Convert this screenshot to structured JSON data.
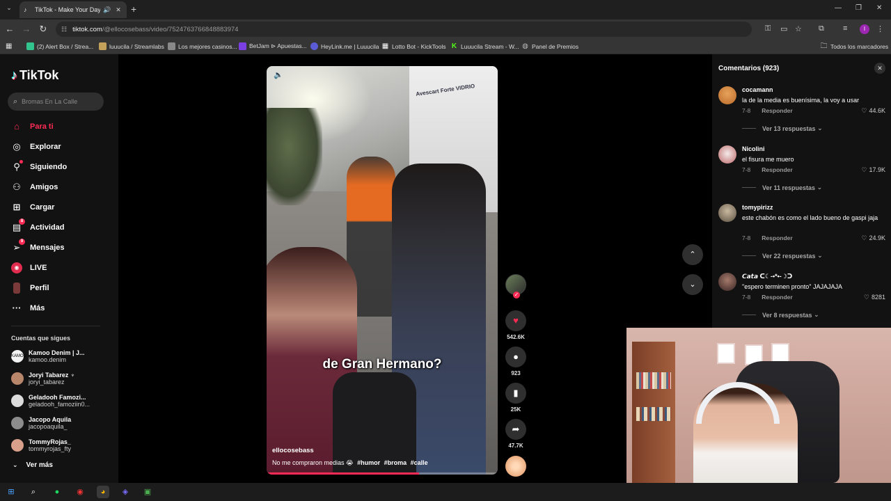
{
  "browser": {
    "tab_title": "TikTok - Make Your Day",
    "url_host": "tiktok.com",
    "url_path": "/@ellocosebass/video/7524763766848883974",
    "bookmarks": [
      {
        "label": "(2) Alert Box / Strea...",
        "color": "#31c48d"
      },
      {
        "label": "luuucila / Streamlabs",
        "color": "#c4a15a"
      },
      {
        "label": "Los mejores casinos...",
        "color": "#888888"
      },
      {
        "label": "BetJam ⊳ Apuestas...",
        "color": "#7b3fe4"
      },
      {
        "label": "HeyLink.me | Luuucila",
        "color": "#5b5bd6"
      },
      {
        "label": "Lotto Bot - KickTools",
        "color": "#ffffff"
      },
      {
        "label": "Luuucila Stream - W...",
        "color": "#53fc18"
      },
      {
        "label": "Panel de Premios",
        "color": "#bbbbbb"
      }
    ],
    "all_bookmarks": "Todos los marcadores"
  },
  "sidebar": {
    "logo": "TikTok",
    "search_placeholder": "Bromas En La Calle",
    "nav": [
      {
        "label": "Para ti",
        "icon": "home-icon",
        "active": true
      },
      {
        "label": "Explorar",
        "icon": "compass-icon"
      },
      {
        "label": "Siguiendo",
        "icon": "following-icon"
      },
      {
        "label": "Amigos",
        "icon": "friends-icon"
      },
      {
        "label": "Cargar",
        "icon": "upload-icon"
      },
      {
        "label": "Actividad",
        "icon": "activity-icon",
        "badge": "8"
      },
      {
        "label": "Mensajes",
        "icon": "messages-icon",
        "badge": "9"
      },
      {
        "label": "LIVE",
        "icon": "live-icon"
      },
      {
        "label": "Perfil",
        "icon": "profile-icon"
      },
      {
        "label": "Más",
        "icon": "more-icon"
      }
    ],
    "following_title": "Cuentas que sigues",
    "following": [
      {
        "name": "Kamoo Denim | J...",
        "handle": "kamoo.denim",
        "color": "#f2f2f2"
      },
      {
        "name": "Joryi Tabarez ♆",
        "handle": "joryi_tabarez",
        "color": "#b8866a"
      },
      {
        "name": "Geladooh Famozi...",
        "handle": "geladooh_famoziin0...",
        "color": "#dcdcdc"
      },
      {
        "name": "Jacopo Aquila",
        "handle": "jacopoaquila_",
        "color": "#8c8c8c"
      },
      {
        "name": "TommyRojas_",
        "handle": "tommyrojas_fty",
        "color": "#d8a08a"
      }
    ],
    "see_more": "Ver más"
  },
  "video": {
    "caption_overlay": "de Gran Hermano?",
    "author": "ellocosebass",
    "description": "No me compraron medias 😭",
    "hashtags": [
      "#humor",
      "#broma",
      "#calle"
    ],
    "truck_text": "Avescart Forte VIDRIO",
    "progress": 0.66,
    "likes": "542.6K",
    "comments": "923",
    "saves": "25K",
    "shares": "47.7K"
  },
  "comments_panel": {
    "title": "Comentarios (923)",
    "items": [
      {
        "user": "cocamann",
        "text": "la de la media es buenísima, la voy a usar",
        "date": "7-8",
        "reply": "Responder",
        "likes": "44.6K",
        "replies": "Ver 13 respuestas",
        "color": "#d9843a"
      },
      {
        "user": "Nicolini",
        "text": "el fisura me muero",
        "date": "7-8",
        "reply": "Responder",
        "likes": "17.9K",
        "replies": "Ver 11 respuestas",
        "color": "#e9e0e0"
      },
      {
        "user": "tomypirizz",
        "text": "este chabón es como el lado bueno de gaspi jaja",
        "date": "7-8",
        "reply": "Responder",
        "likes": "24.9K",
        "replies": "Ver 22 respuestas",
        "color": "#9a8f7a"
      },
      {
        "user": "𝘾𝙖𝙩𝙖 ᑕ☾-•*•-☽ᑐ",
        "text": "\"espero terminen pronto\" JAJAJAJA",
        "date": "7-8",
        "reply": "Responder",
        "likes": "8281",
        "replies": "Ver 8 respuestas",
        "color": "#6a4a4a"
      }
    ]
  },
  "colors": {
    "accent": "#fe2c55",
    "panel": "#121212"
  }
}
